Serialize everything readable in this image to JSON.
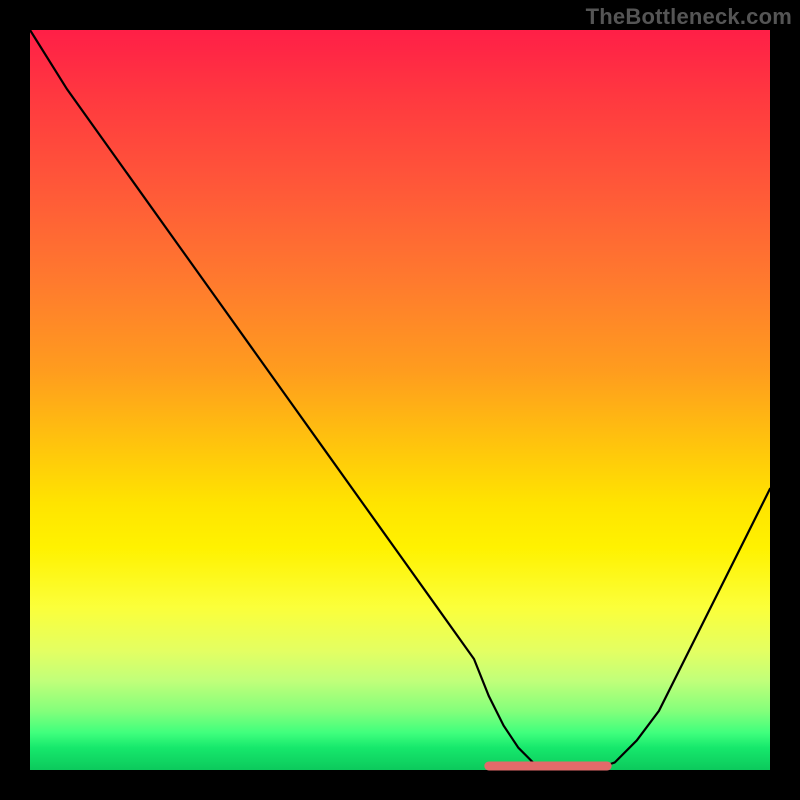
{
  "watermark": "TheBottleneck.com",
  "chart_data": {
    "type": "line",
    "title": "",
    "xlabel": "",
    "ylabel": "",
    "xlim": [
      0,
      100
    ],
    "ylim": [
      0,
      100
    ],
    "grid": false,
    "series": [
      {
        "name": "bottleneck-curve",
        "x": [
          0,
          5,
          10,
          15,
          20,
          25,
          30,
          35,
          40,
          45,
          50,
          55,
          60,
          62,
          64,
          66,
          68,
          70,
          73,
          76,
          79,
          82,
          85,
          88,
          91,
          94,
          97,
          100
        ],
        "values": [
          100,
          92,
          85,
          78,
          71,
          64,
          57,
          50,
          43,
          36,
          29,
          22,
          15,
          10,
          6,
          3,
          1,
          0,
          0,
          0,
          1,
          4,
          8,
          14,
          20,
          26,
          32,
          38
        ]
      }
    ],
    "sweet_spot": {
      "x_start": 62,
      "x_end": 78,
      "y": 0
    },
    "background_gradient": {
      "stops": [
        {
          "pos": 0.0,
          "color": "#ff1f47"
        },
        {
          "pos": 0.5,
          "color": "#ffb400"
        },
        {
          "pos": 0.72,
          "color": "#fff200"
        },
        {
          "pos": 0.92,
          "color": "#84ff7b"
        },
        {
          "pos": 1.0,
          "color": "#0cc95c"
        }
      ]
    }
  }
}
